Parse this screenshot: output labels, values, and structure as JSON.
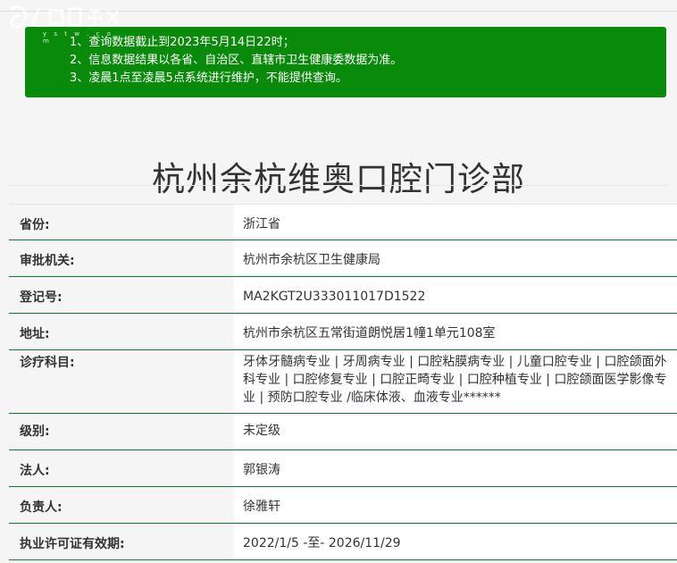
{
  "watermark": {
    "site_text": "y s t w . c o m"
  },
  "notice": {
    "lines": [
      "1、查询数据截止到2023年5月14日22时；",
      "2、信息数据结果以各省、自治区、直辖市卫生健康委数据为准。",
      "3、凌晨1点至凌晨5点系统进行维护，不能提供查询。"
    ],
    "bg_color": "#0a8a0a"
  },
  "title": "杭州余杭维奥口腔门诊部",
  "rows": [
    {
      "label": "省份:",
      "value": "浙江省"
    },
    {
      "label": "审批机关:",
      "value": "杭州市余杭区卫生健康局"
    },
    {
      "label": "登记号:",
      "value": "MA2KGT2U333011017D1522"
    },
    {
      "label": "地址:",
      "value": "杭州市余杭区五常街道朗悦居1幢1单元108室"
    },
    {
      "label": "诊疗科目:",
      "value": "牙体牙髓病专业 | 牙周病专业 | 口腔粘膜病专业 | 儿童口腔专业 | 口腔颌面外科专业 | 口腔修复专业 | 口腔正畸专业 | 口腔种植专业 | 口腔颌面医学影像专业 | 预防口腔专业 /临床体液、血液专业******"
    },
    {
      "label": "级别:",
      "value": "未定级"
    },
    {
      "label": "法人:",
      "value": "郭银涛"
    },
    {
      "label": "负责人:",
      "value": "徐雅轩"
    },
    {
      "label": "执业许可证有效期:",
      "value": "2022/1/5 -至- 2026/11/29"
    }
  ],
  "colors": {
    "accent": "#0e7a32",
    "page_bg": "#f5f5f5",
    "value_bg": "#ffffff"
  }
}
